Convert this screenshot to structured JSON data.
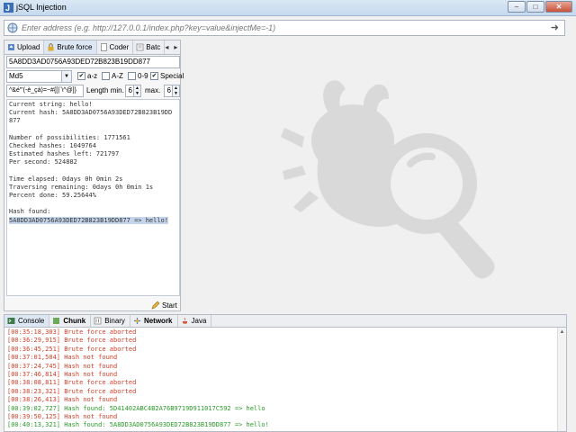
{
  "window": {
    "title": "jSQL Injection",
    "buttons": {
      "minimize": "–",
      "maximize": "□",
      "close": "✕"
    }
  },
  "address": {
    "placeholder": "Enter address (e.g. http://127.0.0.1/index.php?key=value&injectMe=-1)",
    "go_icon": "arrow-right-icon"
  },
  "left_tabs": [
    {
      "label": "Upload",
      "icon": "upload-icon"
    },
    {
      "label": "Brute force",
      "icon": "padlock-icon",
      "active": true
    },
    {
      "label": "Coder",
      "icon": "document-icon"
    },
    {
      "label": "Batc",
      "icon": "batch-icon"
    }
  ],
  "tab_nav": {
    "prev": "◂",
    "next": "▸"
  },
  "bruteforce": {
    "hash_value": "5A8DD3AD0756A93DED72B823B19DD877",
    "algorithm": "Md5",
    "checkboxes": [
      {
        "label": "a-z",
        "checked": true
      },
      {
        "label": "A-Z",
        "checked": false
      },
      {
        "label": "0-9",
        "checked": false
      },
      {
        "label": "Special",
        "checked": true
      }
    ],
    "exclude_value": "^&é\"'(-è_çà)=~#{[|`\\^@]}",
    "length_min_label": "Length min.",
    "length_min": "6",
    "max_label": "max.",
    "length_max": "6",
    "start_label": "Start",
    "output_lines": [
      "Current string: hello!",
      "Current hash: 5A8DD3AD0756A93DED72B823B19DD",
      "877",
      "",
      "Number of possibilities: 1771561",
      "Checked hashes: 1049764",
      "Estimated hashes left: 721797",
      "Per second: 524882",
      "",
      "Time elapsed: 0days 0h 0min 2s",
      "Traversing remaining: 0days 0h 0min 1s",
      "Percent done: 59.25644%",
      "",
      "Hash found:",
      "5A8DD3AD0756A93DED72B823B19DD877 => hello!"
    ]
  },
  "console_tabs": [
    {
      "label": "Console",
      "icon": "console-icon",
      "active": true
    },
    {
      "label": "Chunk",
      "icon": "chunk-icon",
      "bold": true
    },
    {
      "label": "Binary",
      "icon": "binary-icon"
    },
    {
      "label": "Network",
      "icon": "network-icon",
      "bold": true
    },
    {
      "label": "Java",
      "icon": "java-icon"
    }
  ],
  "logs": [
    {
      "text": "[00:35:18,303] Brute force aborted",
      "type": "error"
    },
    {
      "text": "[00:36:29,915] Brute force aborted",
      "type": "error"
    },
    {
      "text": "[00:36:45,251] Brute force aborted",
      "type": "error"
    },
    {
      "text": "[00:37:01,504] Hash not found",
      "type": "error"
    },
    {
      "text": "[00:37:24,745] Hash not found",
      "type": "error"
    },
    {
      "text": "[00:37:46,814] Hash not found",
      "type": "error"
    },
    {
      "text": "[00:38:08,811] Brute force aborted",
      "type": "error"
    },
    {
      "text": "[00:38:23,321] Brute force aborted",
      "type": "error"
    },
    {
      "text": "[00:38:26,413] Hash not found",
      "type": "error"
    },
    {
      "text": "[00:39:02,727] Hash found: 5D41402ABC4B2A76B9719D911017C592 => hello",
      "type": "success"
    },
    {
      "text": "[00:39:50,125] Hash not found",
      "type": "error"
    },
    {
      "text": "[00:40:13,321] Hash found: 5A8DD3AD0756A93DED72B823B19DD877 => hello!",
      "type": "success"
    }
  ],
  "colors": {
    "error": "#d0402a",
    "success": "#2a9a2a",
    "selection": "#c5d6ec",
    "logo": "#d9d9d9"
  }
}
